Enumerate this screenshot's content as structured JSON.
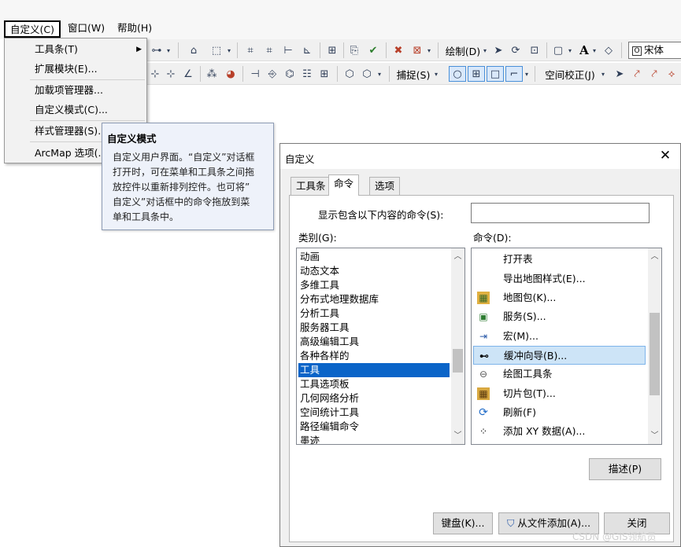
{
  "menubar": {
    "items": [
      {
        "label": "自定义(C)"
      },
      {
        "label": "窗口(W)"
      },
      {
        "label": "帮助(H)"
      }
    ]
  },
  "toolbar1": {
    "draw_label": "绘制(D)",
    "font_value": "宋体",
    "text_tool": "A"
  },
  "toolbar2": {
    "snap_label": "捕捉(S)",
    "spatial_label": "空间校正(J)"
  },
  "context_menu": {
    "items": [
      {
        "label": "工具条(T)",
        "has_submenu": true
      },
      {
        "label": "扩展模块(E)..."
      },
      {
        "label": "加载项管理器..."
      },
      {
        "label": "自定义模式(C)..."
      },
      {
        "label": "样式管理器(S)..."
      },
      {
        "label": "ArcMap 选项(..."
      }
    ]
  },
  "tooltip": {
    "title": "自定义模式",
    "lines": [
      "自定义用户界面。“自定义”对话框",
      "打开时，可在菜单和工具条之间拖",
      "放控件以重新排列控件。也可将”",
      "自定义”对话框中的命令拖放到菜",
      "单和工具条中。"
    ]
  },
  "dialog": {
    "title": "自定义",
    "tabs": [
      {
        "label": "工具条",
        "active": false
      },
      {
        "label": "命令",
        "active": true
      },
      {
        "label": "选项",
        "active": false
      }
    ],
    "search_label": "显示包含以下内容的命令(S):",
    "search_value": "",
    "category_label": "类别(G):",
    "commands_label": "命令(D):",
    "categories": [
      "动画",
      "动态文本",
      "多维工具",
      "分布式地理数据库",
      "分析工具",
      "服务器工具",
      "高级编辑工具",
      "各种各样的",
      "工具",
      "工具选项板",
      "几何网络分析",
      "空间统计工具",
      "路径编辑命令",
      "墨迹"
    ],
    "selected_category": "工具",
    "commands": [
      {
        "label": "打开表",
        "icon": "blank-icon"
      },
      {
        "label": "导出地图样式(E)...",
        "icon": "blank-icon"
      },
      {
        "label": "地图包(K)...",
        "icon": "map-package-icon"
      },
      {
        "label": "服务(S)...",
        "icon": "service-icon"
      },
      {
        "label": "宏(M)...",
        "icon": "macro-icon"
      },
      {
        "label": "缓冲向导(B)...",
        "icon": "buffer-wizard-icon"
      },
      {
        "label": "绘图工具条",
        "icon": "drawing-toolbar-icon"
      },
      {
        "label": "切片包(T)...",
        "icon": "tile-package-icon"
      },
      {
        "label": "刷新(F)",
        "icon": "refresh-icon"
      },
      {
        "label": "添加 XY 数据(A)...",
        "icon": "add-xy-data-icon"
      }
    ],
    "selected_command": "缓冲向导(B)...",
    "describe_button": "描述(P)",
    "keyboard_button": "键盘(K)...",
    "add_from_file_button": "从文件添加(A)...",
    "close_button": "关闭"
  },
  "watermark": "CSDN @GIS领航员"
}
